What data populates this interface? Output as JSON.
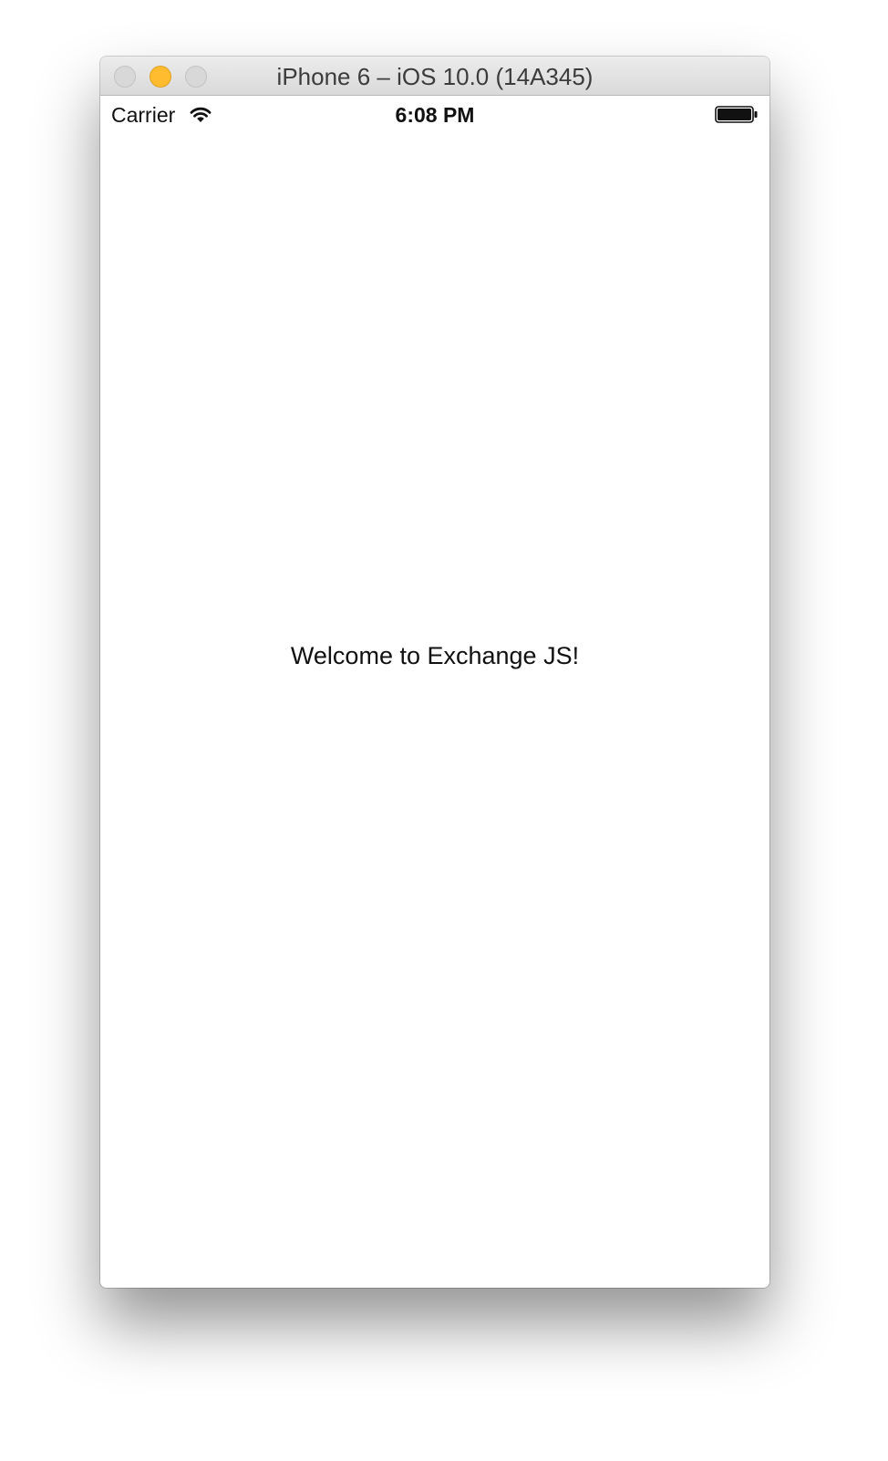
{
  "window": {
    "title": "iPhone 6 – iOS 10.0 (14A345)"
  },
  "status_bar": {
    "carrier": "Carrier",
    "time": "6:08 PM",
    "wifi_icon": "wifi-icon",
    "battery_icon": "battery-icon"
  },
  "app": {
    "welcome_text": "Welcome to Exchange JS!"
  },
  "colors": {
    "minimize_button": "#febc2e",
    "titlebar": "#e3e3e3",
    "screen_background": "#ffffff"
  }
}
